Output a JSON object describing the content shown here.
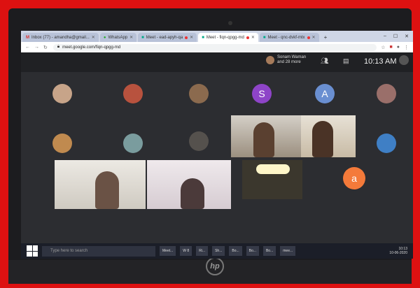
{
  "browser": {
    "tabs": [
      {
        "label": "Inbox (77) - amandha@gmail...",
        "active": false
      },
      {
        "label": "WhatsApp",
        "active": false
      },
      {
        "label": "Meet - ead-apyh-qa",
        "active": false
      },
      {
        "label": "Meet - fiqn-qpgg-md",
        "active": true
      },
      {
        "label": "Meet - qnc-dvkf-mtx",
        "active": false
      }
    ],
    "url": "meet.google.com/fiqn-qpgg-md",
    "window_controls": [
      "–",
      "☐",
      "✕"
    ]
  },
  "meet": {
    "host_name": "Sonam Waman",
    "host_more": "and 28 more",
    "time": "10:13 AM",
    "letter_avatars": [
      {
        "letter": "S",
        "color": "#8e44c8"
      },
      {
        "letter": "A",
        "color": "#6a8fd1"
      },
      {
        "letter": "a",
        "color": "#f47a3a"
      }
    ]
  },
  "taskbar": {
    "search_placeholder": "Type here to search",
    "apps": [
      "Meet...",
      "W 8",
      "Ri...",
      "Sh...",
      "Bo...",
      "Bo...",
      "Bo...",
      "mee..."
    ],
    "clock_time": "10:13",
    "clock_date": "10-06-2020"
  },
  "colors": {
    "frame": "#d11",
    "meet_bg": "#2c2d31"
  }
}
